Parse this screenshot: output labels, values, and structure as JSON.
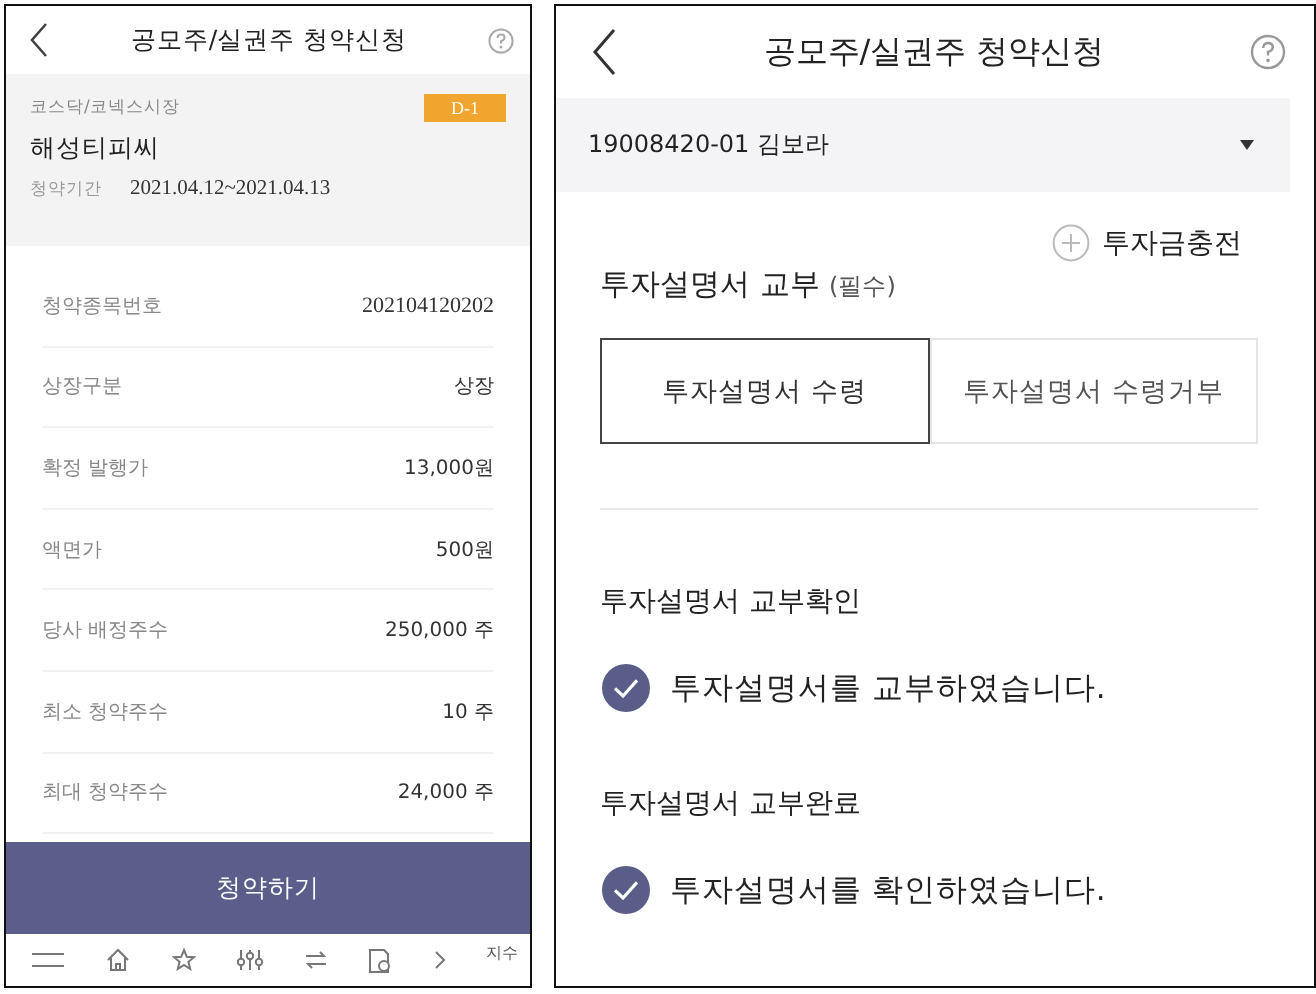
{
  "left": {
    "title": "공모주/실권주 청약신청",
    "market": "코스닥/코넥스시장",
    "badge": "D-1",
    "name": "해성티피씨",
    "period_label": "청약기간",
    "period": "2021.04.12~2021.04.13",
    "rows": [
      {
        "label": "청약종목번호",
        "value": "202104120202"
      },
      {
        "label": "상장구분",
        "value": "상장"
      },
      {
        "label": "확정 발행가",
        "value": "13,000원"
      },
      {
        "label": "액면가",
        "value": "500원"
      },
      {
        "label": "당사 배정주수",
        "value": "250,000 주"
      },
      {
        "label": "최소 청약주수",
        "value": "10 주"
      },
      {
        "label": "최대 청약주수",
        "value": "24,000 주"
      }
    ],
    "submit": "청약하기",
    "nav_index": "지수"
  },
  "right": {
    "title": "공모주/실권주 청약신청",
    "account": "19008420-01 김보라",
    "fund_button": "투자금충전",
    "section_title": "투자설명서 교부",
    "section_required": "(필수)",
    "options": [
      {
        "label": "투자설명서 수령",
        "selected": true
      },
      {
        "label": "투자설명서 수령거부",
        "selected": false
      }
    ],
    "confirmations": [
      {
        "label": "투자설명서 교부확인",
        "text": "투자설명서를 교부하였습니다.",
        "checked": true
      },
      {
        "label": "투자설명서 교부완료",
        "text": "투자설명서를 확인하였습니다.",
        "checked": true
      }
    ]
  }
}
